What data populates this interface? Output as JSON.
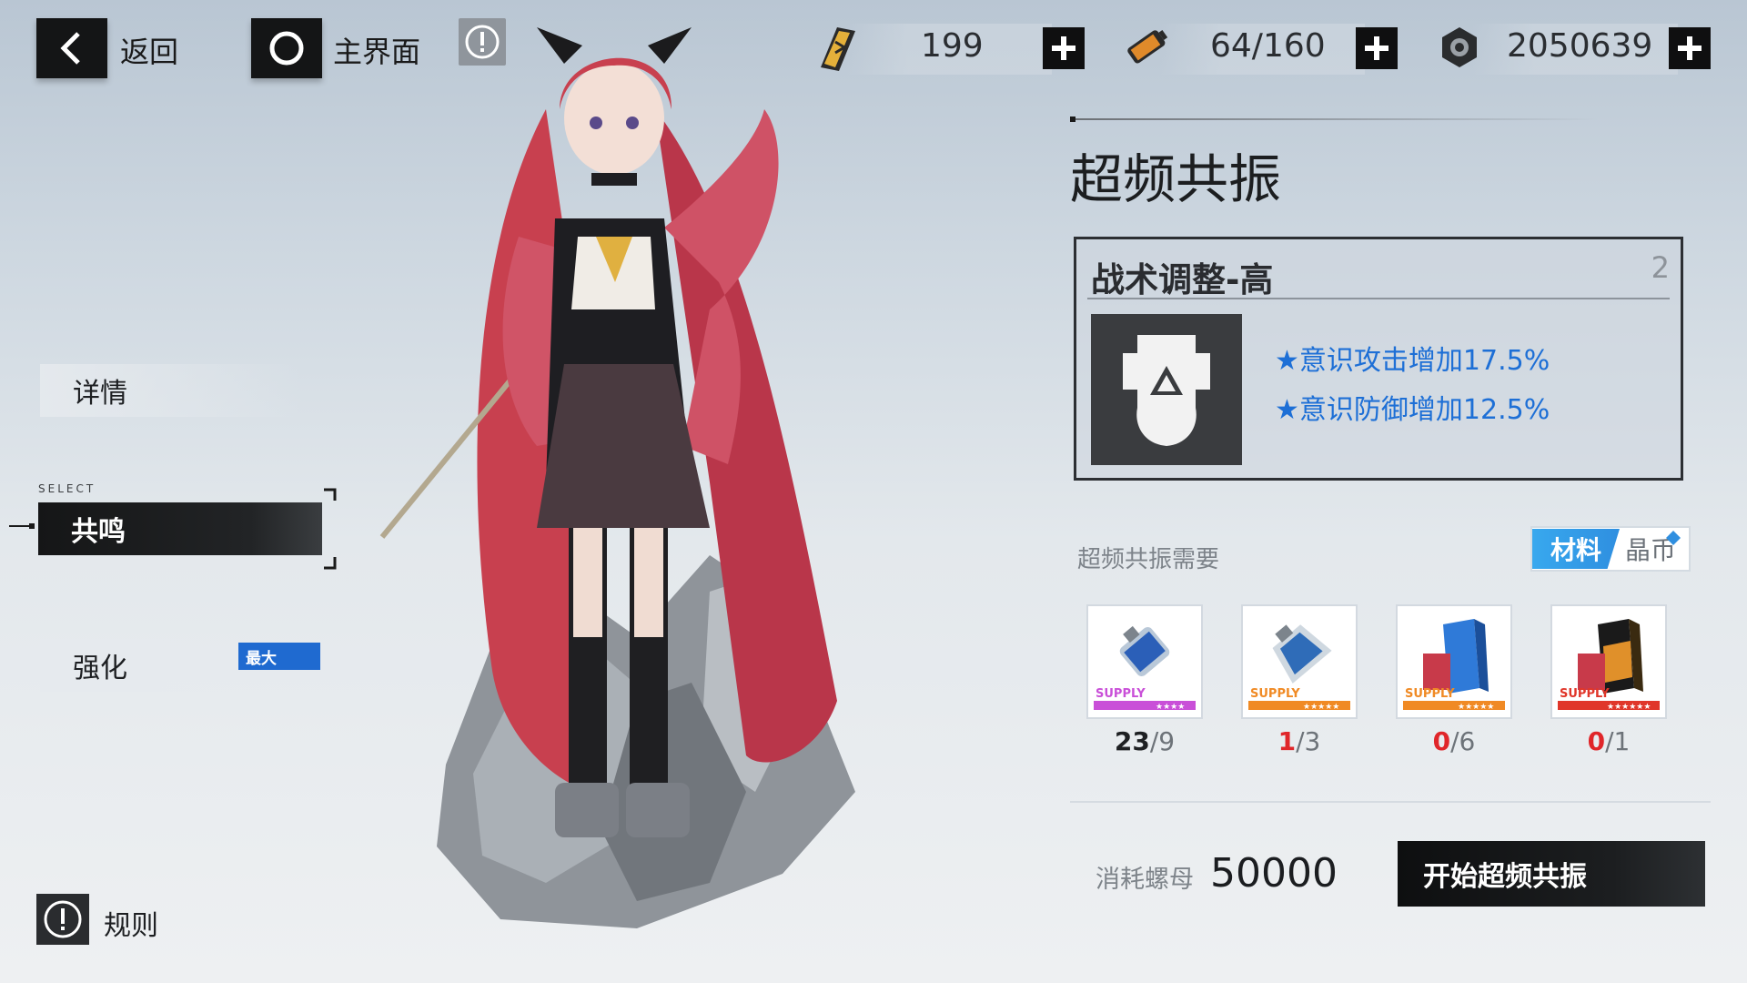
{
  "top_bar": {
    "back_label": "返回",
    "home_label": "主界面",
    "resources": [
      {
        "icon": "ticket-icon",
        "value": "199"
      },
      {
        "icon": "battery-icon",
        "value": "64/160"
      },
      {
        "icon": "screw-nut-icon",
        "value": "2050639"
      }
    ]
  },
  "left_menu": {
    "details": "详情",
    "select_tag": "SELECT",
    "resonance": "共鸣",
    "enhance": "强化",
    "max_badge": "最大",
    "rules": "规则"
  },
  "panel": {
    "title": "超频共振",
    "skill": {
      "name": "战术调整-高",
      "level": "2",
      "effects": [
        "意识攻击增加17.5%",
        "意识防御增加12.5%"
      ]
    },
    "requirements_label": "超频共振需要",
    "tabs": {
      "active": "材料",
      "idle": "晶币"
    },
    "items": [
      {
        "have": "23",
        "need": "/9",
        "color": "#c94fd8",
        "stars": "★★★★",
        "tag": "SUPPLY"
      },
      {
        "have": "1",
        "need": "/3",
        "color": "#f08a24",
        "stars": "★★★★★",
        "tag": "SUPPLY"
      },
      {
        "have": "0",
        "need": "/6",
        "color": "#f08a24",
        "stars": "★★★★★",
        "tag": "SUPPLY"
      },
      {
        "have": "0",
        "need": "/1",
        "color": "#e0362a",
        "stars": "★★★★★★",
        "tag": "SUPPLY"
      }
    ],
    "cost_label": "消耗螺母",
    "cost_value": "50000",
    "start_button": "开始超频共振"
  }
}
